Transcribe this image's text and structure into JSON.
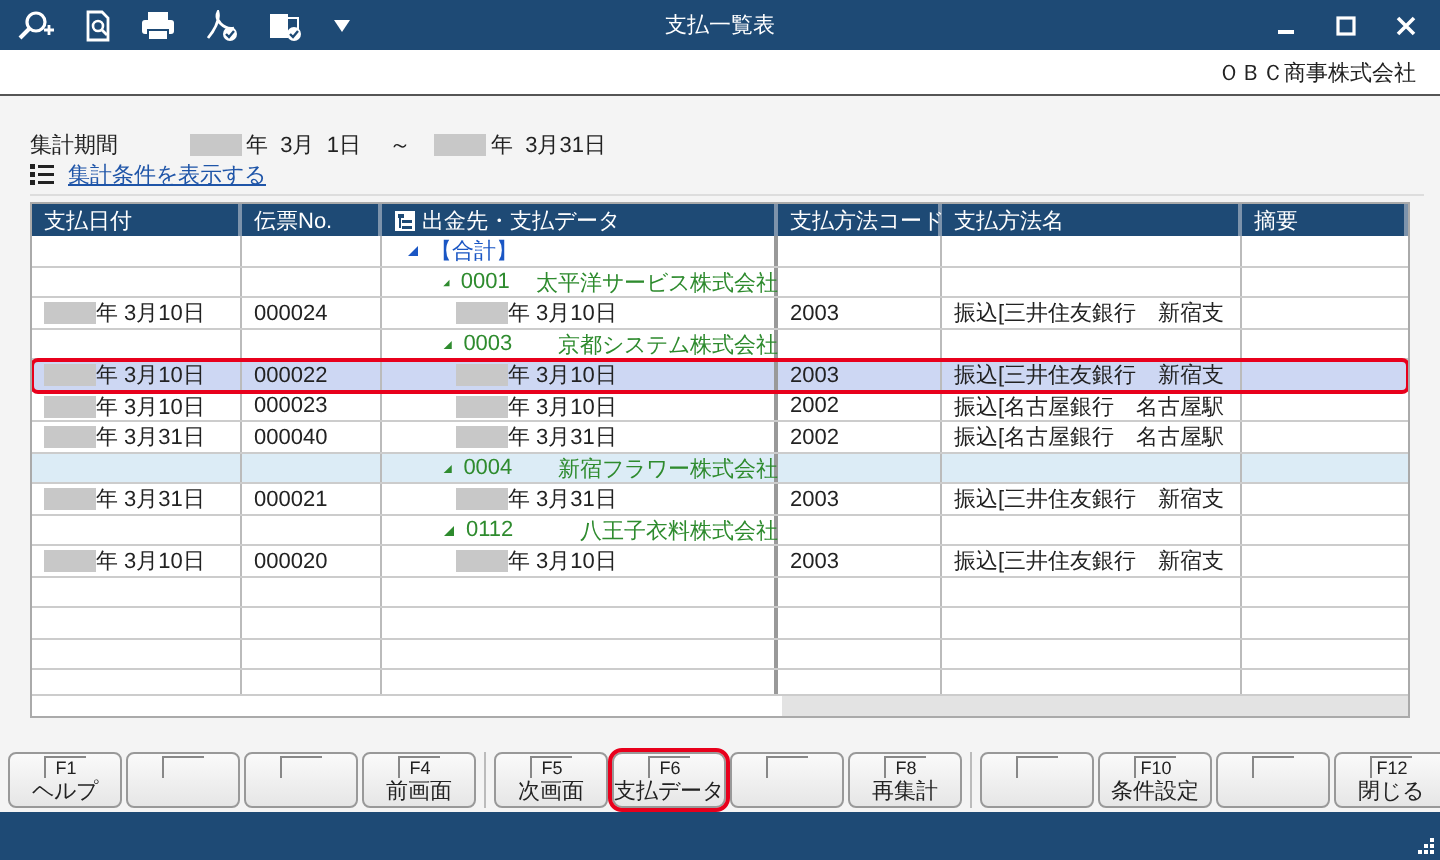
{
  "window": {
    "title": "支払一覧表"
  },
  "company": "ＯＢＣ商事株式会社",
  "period": {
    "label": "集計期間",
    "from": "年  3月  1日",
    "separator": "～",
    "to": "年  3月31日"
  },
  "conditions_link": "集計条件を表示する",
  "table": {
    "columns": [
      "支払日付",
      "伝票No.",
      "出金先・支払データ",
      "支払方法コード",
      "支払方法名",
      "摘要"
    ],
    "total": {
      "label": "【合計】",
      "expanded": true,
      "selected": false,
      "shaded": false,
      "children": [
        {
          "code": "0001",
          "name": "太平洋サービス株式会社",
          "expanded": true,
          "selected": false,
          "shaded": false,
          "callout": false,
          "children": [
            {
              "date": "年  3月10日",
              "slip_no": "000024",
              "pay_date": "年 3月10日",
              "method_code": "2003",
              "method_name": "振込[三井住友銀行　新宿支",
              "selected": false,
              "shaded": false,
              "callout": false
            }
          ]
        },
        {
          "code": "0003",
          "name": "京都システム株式会社",
          "expanded": true,
          "selected": false,
          "shaded": false,
          "callout": false,
          "children": [
            {
              "date": "年  3月10日",
              "slip_no": "000022",
              "pay_date": "年 3月10日",
              "method_code": "2003",
              "method_name": "振込[三井住友銀行　新宿支",
              "selected": true,
              "shaded": false,
              "callout": true
            },
            {
              "date": "年  3月10日",
              "slip_no": "000023",
              "pay_date": "年 3月10日",
              "method_code": "2002",
              "method_name": "振込[名古屋銀行　名古屋駅",
              "selected": false,
              "shaded": false,
              "callout": false
            },
            {
              "date": "年  3月31日",
              "slip_no": "000040",
              "pay_date": "年 3月31日",
              "method_code": "2002",
              "method_name": "振込[名古屋銀行　名古屋駅",
              "selected": false,
              "shaded": false,
              "callout": false
            }
          ]
        },
        {
          "code": "0004",
          "name": "新宿フラワー株式会社",
          "expanded": true,
          "selected": false,
          "shaded": true,
          "callout": false,
          "children": [
            {
              "date": "年  3月31日",
              "slip_no": "000021",
              "pay_date": "年 3月31日",
              "method_code": "2003",
              "method_name": "振込[三井住友銀行　新宿支",
              "selected": false,
              "shaded": false,
              "callout": false
            }
          ]
        },
        {
          "code": "0112",
          "name": "八王子衣料株式会社",
          "expanded": true,
          "selected": false,
          "shaded": false,
          "callout": false,
          "children": [
            {
              "date": "年  3月10日",
              "slip_no": "000020",
              "pay_date": "年 3月10日",
              "method_code": "2003",
              "method_name": "振込[三井住友銀行　新宿支",
              "selected": false,
              "shaded": false,
              "callout": false
            }
          ]
        }
      ]
    }
  },
  "function_keys": [
    {
      "key": "F1",
      "label": "ヘルプ",
      "callout": false
    },
    {
      "callout": false
    },
    {
      "callout": false
    },
    {
      "key": "F4",
      "label": "前画面",
      "callout": false
    },
    {
      "key": "F5",
      "label": "次画面",
      "callout": false
    },
    {
      "key": "F6",
      "label": "支払データ",
      "callout": true
    },
    {
      "callout": false
    },
    {
      "key": "F8",
      "label": "再集計",
      "callout": false
    },
    {
      "callout": false
    },
    {
      "key": "F10",
      "label": "条件設定",
      "callout": false
    },
    {
      "callout": false
    },
    {
      "key": "F12",
      "label": "閉じる",
      "callout": false
    }
  ]
}
